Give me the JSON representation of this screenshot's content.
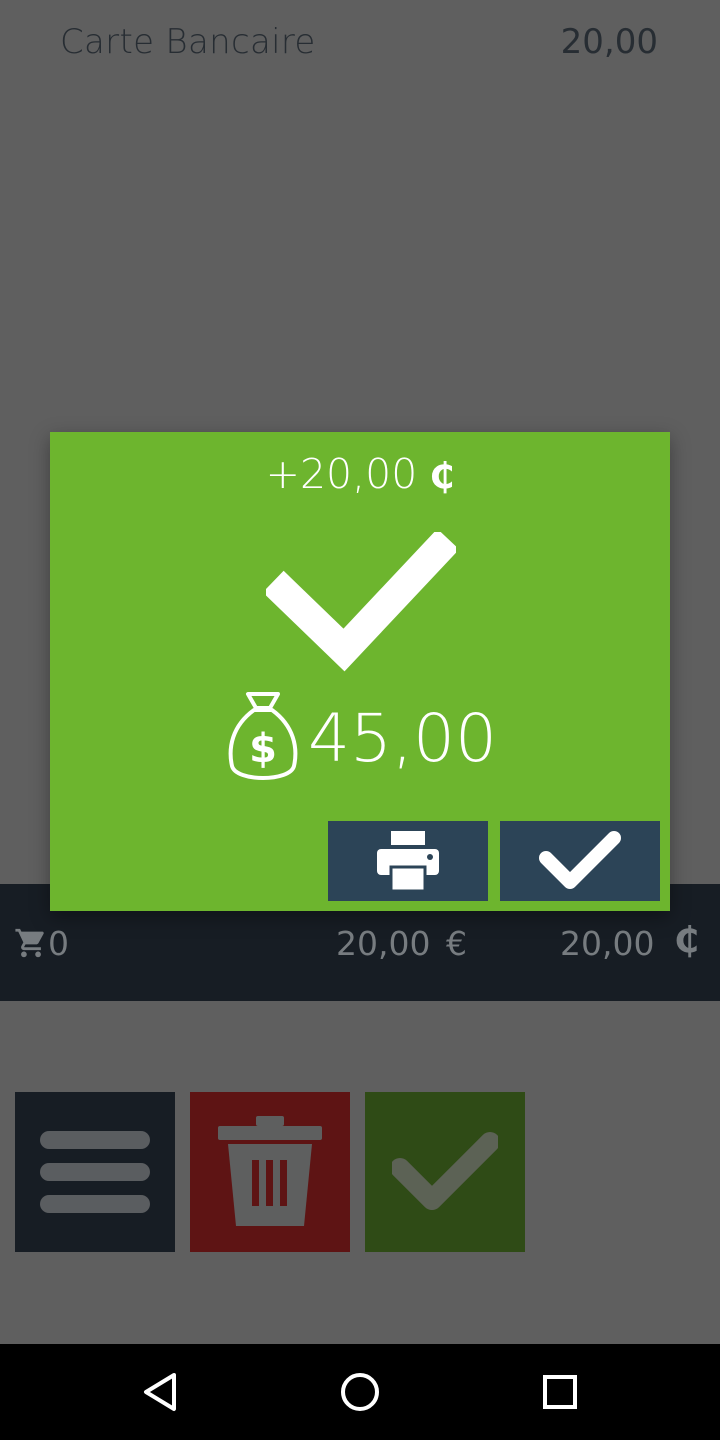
{
  "payment": {
    "method": "Carte Bancaire",
    "amount": "20,00"
  },
  "totals": {
    "cart_count": "0",
    "total_eur": "20,00",
    "eur_symbol": "€",
    "total_currency": "20,00",
    "currency_symbol": "₵"
  },
  "actions": {
    "menu_icon": "hamburger-icon",
    "delete_icon": "trash-icon",
    "validate_icon": "check-icon"
  },
  "popup": {
    "delta": "+20,00",
    "currency_symbol": "₵",
    "balance": "45,00",
    "print_icon": "printer-icon",
    "ok_icon": "check-icon"
  },
  "colors": {
    "popup_bg": "#6db52e",
    "popup_button": "#2c4457",
    "dark_bar": "#171d24",
    "delete_red": "#5e1414",
    "validate_green": "#2f4b16"
  },
  "nav": {
    "back": "back-icon",
    "home": "home-icon",
    "recents": "recents-icon"
  }
}
